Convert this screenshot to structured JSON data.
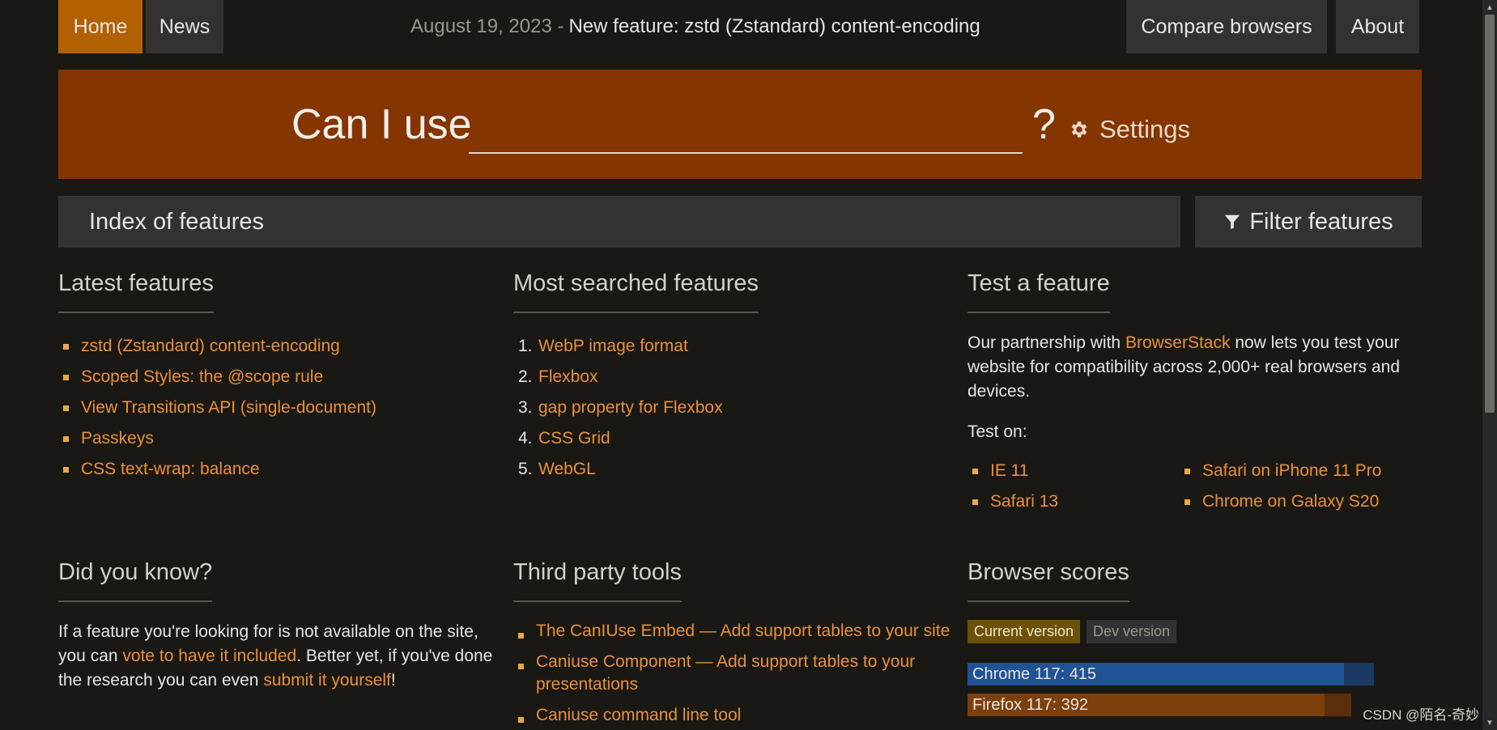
{
  "nav": {
    "home": "Home",
    "news": "News",
    "compare": "Compare browsers",
    "about": "About",
    "announce_date": "August 19, 2023 -",
    "announce_text": "New feature: zstd (Zstandard) content-encoding"
  },
  "hero": {
    "label": "Can I use",
    "search_placeholder": "",
    "question": "?",
    "settings": "Settings"
  },
  "index": {
    "title": "Index of features",
    "filter": "Filter features"
  },
  "latest": {
    "title": "Latest features",
    "items": [
      "zstd (Zstandard) content-encoding",
      "Scoped Styles: the @scope rule",
      "View Transitions API (single-document)",
      "Passkeys",
      "CSS text-wrap: balance"
    ]
  },
  "most_searched": {
    "title": "Most searched features",
    "items": [
      "WebP image format",
      "Flexbox",
      "gap property for Flexbox",
      "CSS Grid",
      "WebGL"
    ]
  },
  "test": {
    "title": "Test a feature",
    "text_before": "Our partnership with",
    "link": "BrowserStack",
    "text_after": "now lets you test your website for compatibility across 2,000+ real browsers and devices.",
    "test_on": "Test on:",
    "browsers": [
      "IE 11",
      "Safari on iPhone 11 Pro",
      "Safari 13",
      "Chrome on Galaxy S20"
    ]
  },
  "did_you_know": {
    "title": "Did you know?",
    "t1": "If a feature you're looking for is not available on the site, you can",
    "l1": "vote to have it included",
    "t2": ". Better yet, if you've done the research you can even",
    "l2": "submit it yourself",
    "t3": "!"
  },
  "third_party": {
    "title": "Third party tools",
    "items": [
      "The CanIUse Embed — Add support tables to your site",
      "Caniuse Component — Add support tables to your presentations",
      "Caniuse command line tool"
    ]
  },
  "scores": {
    "title": "Browser scores",
    "tab_current": "Current version",
    "tab_dev": "Dev version",
    "bars": [
      {
        "label": "Chrome 117: 415",
        "value": 415,
        "color": "#1f5394"
      },
      {
        "label": "Firefox 117: 392",
        "value": 392,
        "color": "#7d3f0c"
      }
    ]
  },
  "watermark": "CSDN @陌名-奇妙"
}
